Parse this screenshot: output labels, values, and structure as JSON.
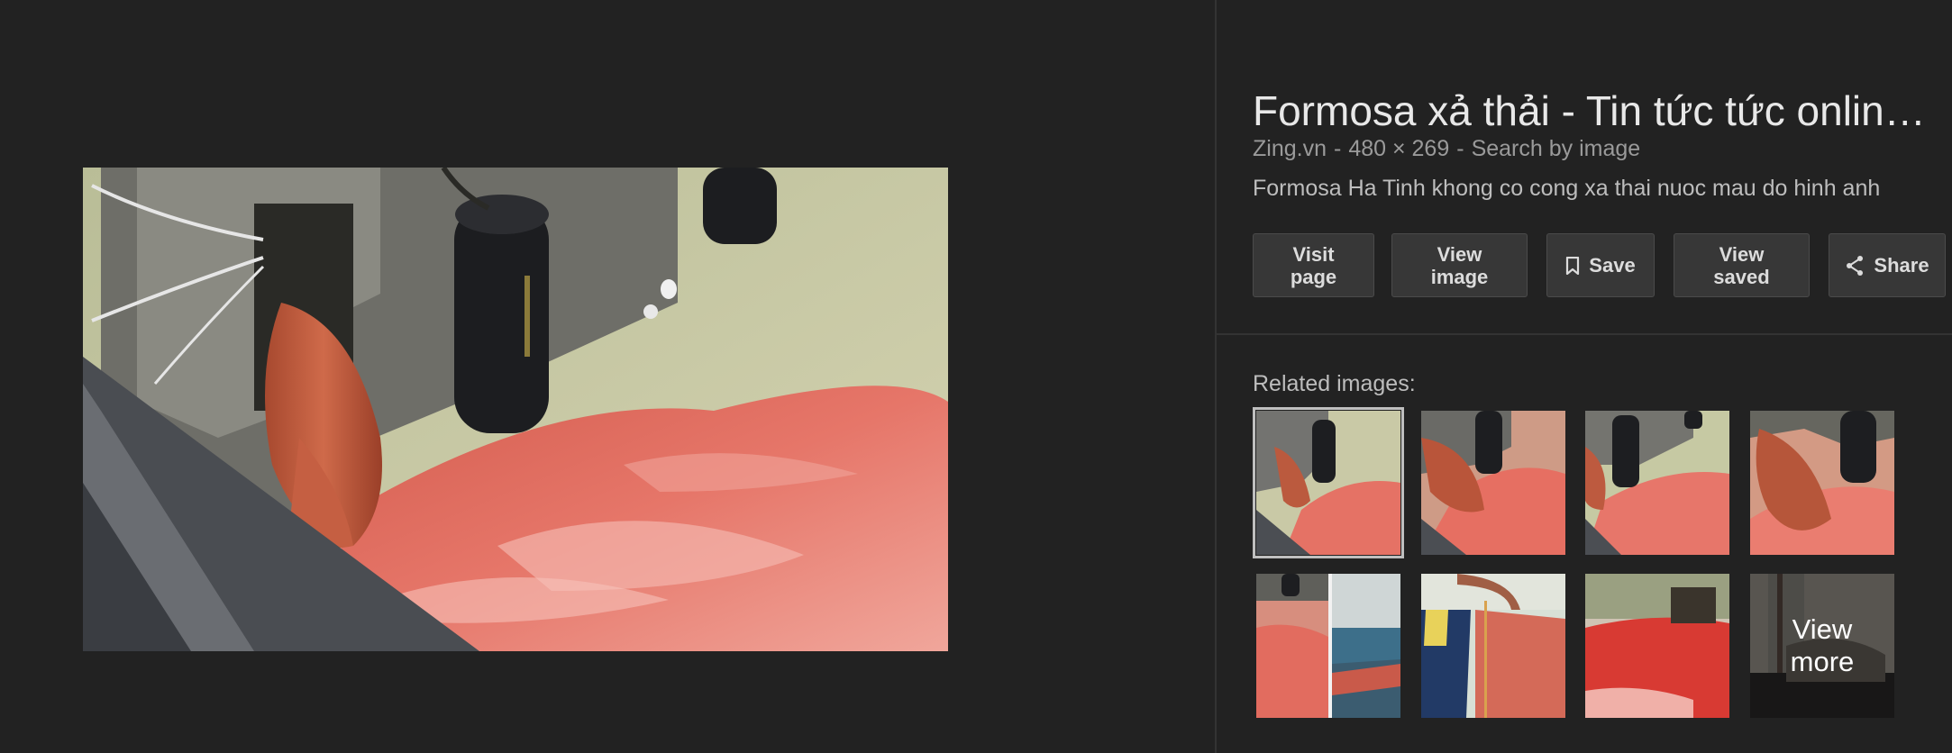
{
  "details": {
    "title": "Formosa xả thải - Tin tức tức online ...",
    "source": "Zing.vn",
    "dimensions": "480 × 269",
    "search_by_image": "Search by image",
    "description": "Formosa Ha Tinh khong co cong xa thai nuoc mau do hinh anh"
  },
  "actions": {
    "visit_line1": "Visit",
    "visit_line2": "page",
    "view_line1": "View",
    "view_line2": "image",
    "save": "Save",
    "saved_line1": "View",
    "saved_line2": "saved",
    "share": "Share",
    "save_icon": "bookmark-icon",
    "share_icon": "share-icon"
  },
  "related": {
    "heading": "Related images:",
    "view_more_line1": "View",
    "view_more_line2": "more"
  },
  "colors": {
    "background": "#222222",
    "button_bg": "#373737",
    "red_water": "#e0685f",
    "silt_water": "#c6c8a2"
  }
}
